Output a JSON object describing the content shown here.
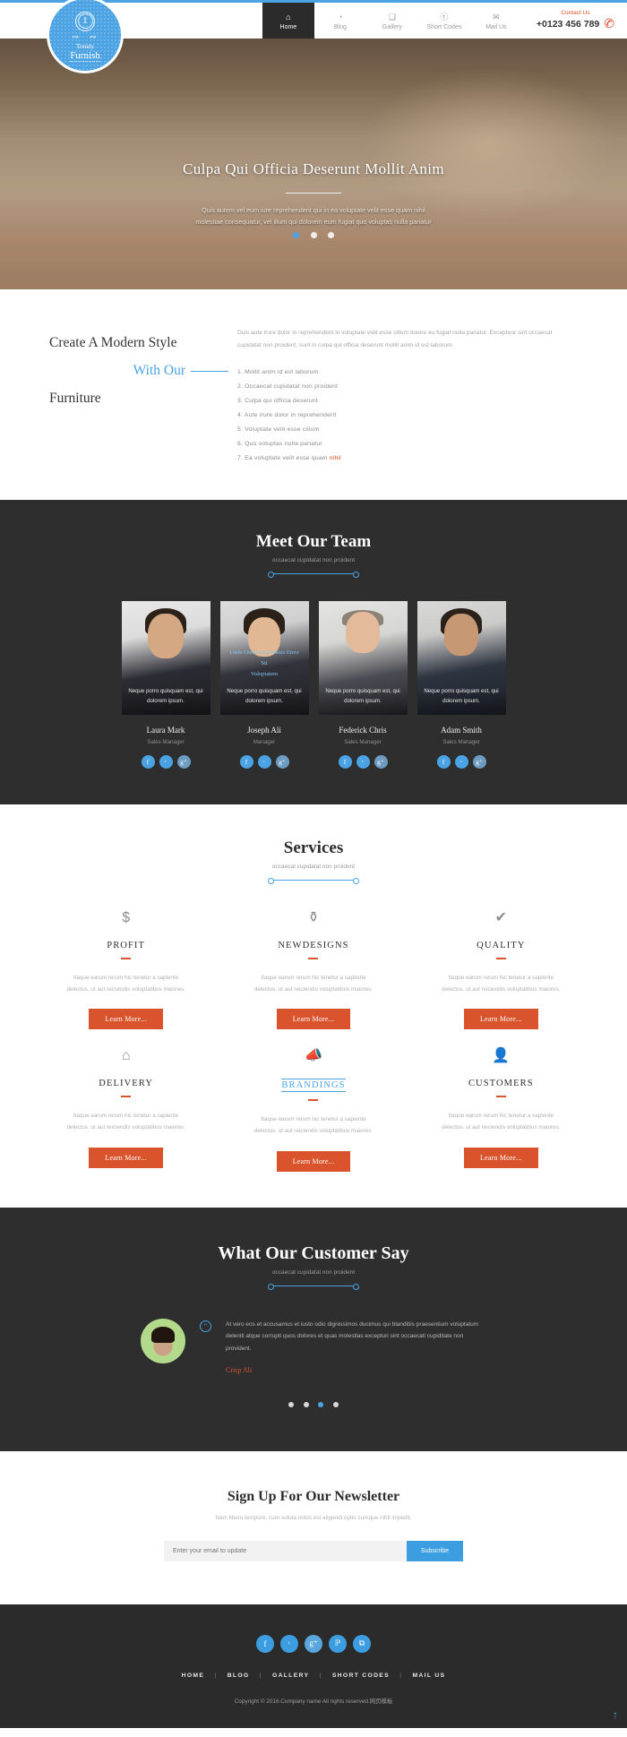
{
  "brand": {
    "mark": "I",
    "name_top": "Trendy",
    "name_bottom": "Furnish"
  },
  "nav": {
    "items": [
      {
        "label": "Home",
        "icon": "home-icon",
        "glyph": "⌂",
        "active": true
      },
      {
        "label": "Blog",
        "icon": "blog-icon",
        "glyph": "◔",
        "active": false
      },
      {
        "label": "Gallery",
        "icon": "gallery-icon",
        "glyph": "❑",
        "active": false
      },
      {
        "label": "Short Codes",
        "icon": "short-codes-icon",
        "glyph": "ⓣ",
        "active": false
      },
      {
        "label": "Mail Us",
        "icon": "mail-icon",
        "glyph": "✉",
        "active": false
      }
    ],
    "contact_label": "Contact Us",
    "contact_number": "+0123 456 789",
    "phone_glyph": "✆"
  },
  "hero": {
    "title": "Culpa Qui Officia Deserunt Mollit Anim",
    "subtitle_line1": "Quis autem vel eum iure reprehenderit qui in ea voluptate velit esse quam nihil",
    "subtitle_line2": "molestiae consequatur, vel illum qui dolorem eum fugiat quo voluptas nulla pariatur",
    "slides": 3,
    "active_slide": 2
  },
  "intro": {
    "heading_line1": "Create A Modern Style",
    "heading_line2": "With Our",
    "heading_line3": "Furniture",
    "paragraph": "Duis aute irure dolor in reprehenderit in voluptate velit esse cillum dolore eu fugiat nulla pariatur. Excepteur sint occaecat cupidatat non proident, sunt in culpa qui officia deserunt mollit anim id est laborum.",
    "list": [
      "1. Mollit anim id est laborum",
      "2. Occaecat cupidatat non proident",
      "3. Culpa qui officia deserunt",
      "4. Aute irure dolor in reprehenderit",
      "5. Voluptate velit esse cillum",
      "6. Quo voluptas nulla pariatur",
      "7. Ea voluptate velit esse quam"
    ],
    "list_last_highlight": "nihil"
  },
  "team": {
    "title": "Meet Our Team",
    "subtitle": "occaecat cupidatat non proident",
    "members": [
      {
        "name": "Laura Mark",
        "role": "Sales Manager",
        "caption_line1": "Neque porro quisquam est, qui",
        "caption_line2": "dolorem ipsum.",
        "hover_line1": "",
        "hover_line2": ""
      },
      {
        "name": "Joseph Ali",
        "role": "Manager",
        "caption_line1": "Neque porro quisquam est, qui",
        "caption_line2": "dolorem ipsum.",
        "hover_line1": "Unde Omnis Iste Natus Error Sit",
        "hover_line2": "Voluptatem"
      },
      {
        "name": "Federick Chris",
        "role": "Sales Manager",
        "caption_line1": "Neque porro quisquam est, qui",
        "caption_line2": "dolorem ipsum.",
        "hover_line1": "",
        "hover_line2": ""
      },
      {
        "name": "Adam Smith",
        "role": "Sales Manager",
        "caption_line1": "Neque porro quisquam est, qui",
        "caption_line2": "dolorem ipsum.",
        "hover_line1": "",
        "hover_line2": ""
      }
    ],
    "social_glyphs": {
      "facebook": "f",
      "twitter": "ᵗ",
      "google": "g⁺"
    }
  },
  "services": {
    "title": "Services",
    "subtitle": "occaecat cupidatat non proident",
    "items": [
      {
        "name": "PROFIT",
        "icon": "dollar-icon",
        "glyph": "$",
        "text_line1": "Itaque earum rerum hic tenetur a sapiente",
        "text_line2": "delectus. ut aut reiciendis voluptatibus maiores.",
        "button": "Learn More...",
        "hot": false
      },
      {
        "name": "NEWDESIGNS",
        "icon": "lamp-icon",
        "glyph": "⚱",
        "text_line1": "Itaque earum rerum hic tenetur a sapiente",
        "text_line2": "delectus. ut aut reiciendis voluptatibus maiores.",
        "button": "Learn More...",
        "hot": false
      },
      {
        "name": "QUALITY",
        "icon": "check-icon",
        "glyph": "✔",
        "text_line1": "Itaque earum rerum hic tenetur a sapiente",
        "text_line2": "delectus. ut aut reiciendis voluptatibus maiores.",
        "button": "Learn More...",
        "hot": false
      },
      {
        "name": "DELIVERY",
        "icon": "home-icon",
        "glyph": "⌂",
        "text_line1": "Itaque earum rerum hic tenetur a sapiente",
        "text_line2": "delectus. ut aut reiciendis voluptatibus maiores.",
        "button": "Learn More...",
        "hot": false
      },
      {
        "name": "BRANDINGS",
        "icon": "megaphone-icon",
        "glyph": "📣",
        "text_line1": "Itaque earum rerum hic tenetur a sapiente",
        "text_line2": "delectus. ut aut reiciendis voluptatibus maiores.",
        "button": "Learn More...",
        "hot": true
      },
      {
        "name": "CUSTOMERS",
        "icon": "user-icon",
        "glyph": "👤",
        "text_line1": "Itaque earum rerum hic tenetur a sapiente",
        "text_line2": "delectus. ut aut reiciendis voluptatibus maiores.",
        "button": "Learn More...",
        "hot": false
      }
    ]
  },
  "testimonial": {
    "title": "What Our Customer Say",
    "subtitle": "occaecat cupidatat non proident",
    "quote_glyph": "“",
    "text": "At vero eos et accusamus et iusto odio dignissimos ducimus qui blanditiis praesentium voluptatum deleniti atque corrupti quos dolores et quas molestias excepturi sint occaecati cupiditate non provident.",
    "author": "Crisp Ali",
    "slides": 4,
    "active_slide": 3
  },
  "newsletter": {
    "title": "Sign Up For Our Newsletter",
    "subtitle": "Nam libero tempore, cum soluta nobis est eligendi optio cumque nihil impedit.",
    "placeholder": "Enter your email to update",
    "button": "Subscribe"
  },
  "footer": {
    "socials": [
      {
        "name": "facebook-icon",
        "glyph": "f"
      },
      {
        "name": "twitter-icon",
        "glyph": "ᵗ"
      },
      {
        "name": "google-plus-icon",
        "glyph": "g⁺"
      },
      {
        "name": "pinterest-icon",
        "glyph": "ℙ"
      },
      {
        "name": "instagram-icon",
        "glyph": "⧉"
      }
    ],
    "links": [
      "HOME",
      "BLOG",
      "GALLERY",
      "SHORT CODES",
      "MAIL US"
    ],
    "separator": "|",
    "copyright": "Copyright © 2016.Company name All rights reserved.网页模板",
    "back_to_top_glyph": "↑"
  },
  "colors": {
    "accent_blue": "#4ba3e3",
    "accent_orange": "#d9532c",
    "dark": "#2e2e2e"
  }
}
